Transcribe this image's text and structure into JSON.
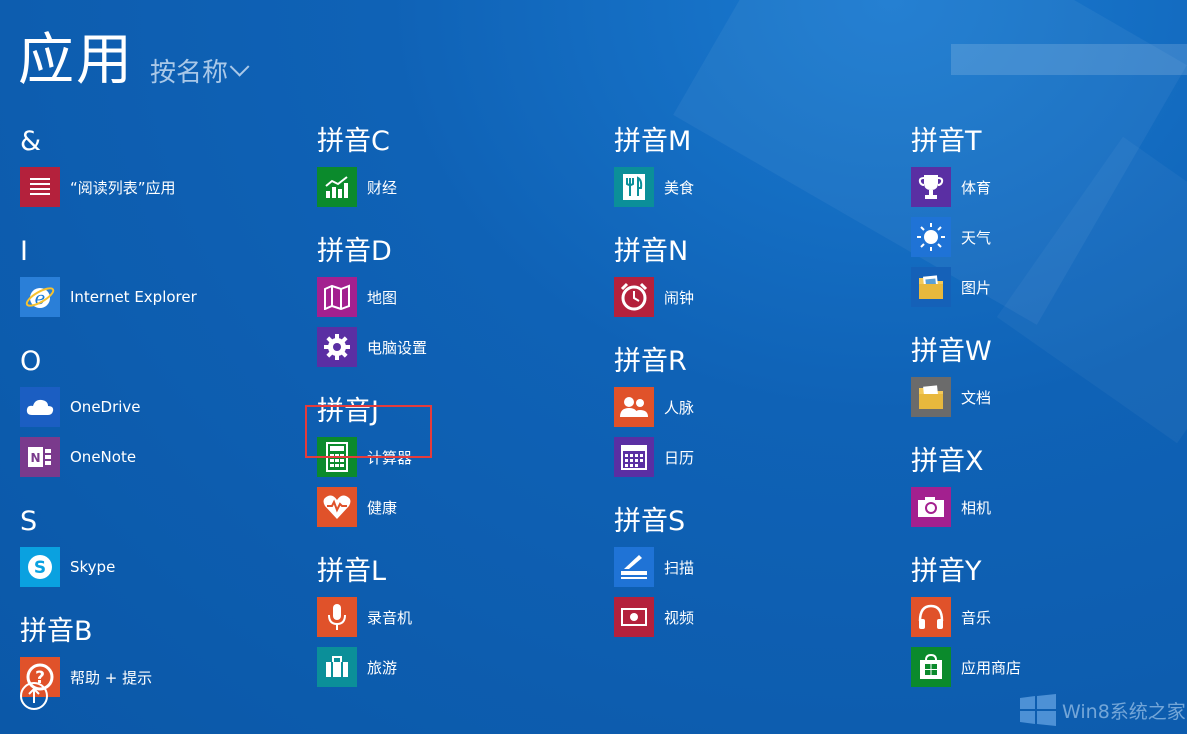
{
  "header": {
    "title": "应用",
    "sort_label": "按名称"
  },
  "columns": [
    {
      "groups": [
        {
          "header": "&",
          "apps": [
            {
              "label": "“阅读列表”应用",
              "icon": "reading-list-icon",
              "color": "#b4213c"
            }
          ]
        },
        {
          "header": "I",
          "apps": [
            {
              "label": "Internet Explorer",
              "icon": "internet-explorer-icon",
              "color": "#2a7fd8"
            }
          ]
        },
        {
          "header": "O",
          "apps": [
            {
              "label": "OneDrive",
              "icon": "onedrive-icon",
              "color": "#1b5ec2"
            },
            {
              "label": "OneNote",
              "icon": "onenote-icon",
              "color": "#7a3a8c"
            }
          ]
        },
        {
          "header": "S",
          "apps": [
            {
              "label": "Skype",
              "icon": "skype-icon",
              "color": "#0aa1e0"
            }
          ]
        },
        {
          "header": "拼音B",
          "apps": [
            {
              "label": "帮助 + 提示",
              "icon": "help-icon",
              "color": "#e0522a"
            }
          ]
        }
      ]
    },
    {
      "groups": [
        {
          "header": "拼音C",
          "apps": [
            {
              "label": "财经",
              "icon": "finance-icon",
              "color": "#0b8a2c"
            }
          ]
        },
        {
          "header": "拼音D",
          "apps": [
            {
              "label": "地图",
              "icon": "maps-icon",
              "color": "#a3208f"
            },
            {
              "label": "电脑设置",
              "icon": "gear-icon",
              "color": "#5a2fa3"
            }
          ]
        },
        {
          "header": "拼音J",
          "apps": [
            {
              "label": "计算器",
              "icon": "calculator-icon",
              "color": "#0b8a2c"
            },
            {
              "label": "健康",
              "icon": "health-icon",
              "color": "#e0522a"
            }
          ]
        },
        {
          "header": "拼音L",
          "apps": [
            {
              "label": "录音机",
              "icon": "microphone-icon",
              "color": "#e0522a"
            },
            {
              "label": "旅游",
              "icon": "travel-icon",
              "color": "#0b8f99"
            }
          ]
        }
      ]
    },
    {
      "groups": [
        {
          "header": "拼音M",
          "apps": [
            {
              "label": "美食",
              "icon": "food-icon",
              "color": "#0b8f99"
            }
          ]
        },
        {
          "header": "拼音N",
          "apps": [
            {
              "label": "闹钟",
              "icon": "alarm-icon",
              "color": "#b4213c"
            }
          ]
        },
        {
          "header": "拼音R",
          "apps": [
            {
              "label": "人脉",
              "icon": "people-icon",
              "color": "#e0522a"
            },
            {
              "label": "日历",
              "icon": "calendar-icon",
              "color": "#5a2fa3"
            }
          ]
        },
        {
          "header": "拼音S",
          "apps": [
            {
              "label": "扫描",
              "icon": "scan-icon",
              "color": "#1f73d6"
            },
            {
              "label": "视频",
              "icon": "video-icon",
              "color": "#b4213c"
            }
          ]
        }
      ]
    },
    {
      "groups": [
        {
          "header": "拼音T",
          "apps": [
            {
              "label": "体育",
              "icon": "sports-trophy-icon",
              "color": "#5a2fa3"
            },
            {
              "label": "天气",
              "icon": "weather-sun-icon",
              "color": "#1f73d6"
            },
            {
              "label": "图片",
              "icon": "photos-icon",
              "color": "#1561b8"
            }
          ]
        },
        {
          "header": "拼音W",
          "apps": [
            {
              "label": "文档",
              "icon": "documents-icon",
              "color": "#6b6b6b"
            }
          ]
        },
        {
          "header": "拼音X",
          "apps": [
            {
              "label": "相机",
              "icon": "camera-icon",
              "color": "#a3208f"
            }
          ]
        },
        {
          "header": "拼音Y",
          "apps": [
            {
              "label": "音乐",
              "icon": "music-headphones-icon",
              "color": "#e0522a"
            },
            {
              "label": "应用商店",
              "icon": "store-icon",
              "color": "#0b8a2c"
            }
          ]
        }
      ]
    }
  ],
  "watermark": {
    "text": "Win8系统之家"
  }
}
